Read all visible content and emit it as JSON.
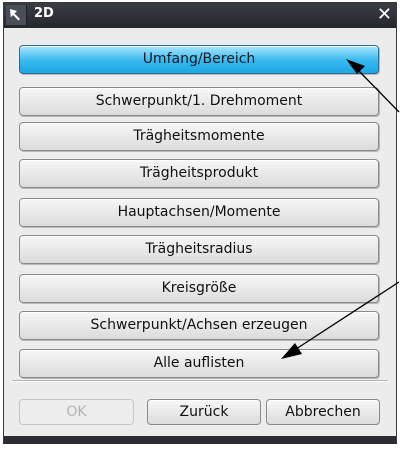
{
  "window": {
    "title": "2D",
    "icon": "cursor-arrow-icon",
    "close_glyph": "✕"
  },
  "menu": {
    "items": [
      {
        "label": "Umfang/Bereich",
        "active": true
      },
      {
        "label": "Schwerpunkt/1. Drehmoment"
      },
      {
        "label": "Trägheitsmomente"
      },
      {
        "label": "Trägheitsprodukt"
      },
      {
        "label": "Hauptachsen/Momente"
      },
      {
        "label": "Trägheitsradius"
      },
      {
        "label": "Kreisgröße"
      },
      {
        "label": "Schwerpunkt/Achsen erzeugen"
      },
      {
        "label": "Alle auflisten"
      }
    ]
  },
  "buttons": {
    "ok": "OK",
    "back": "Zurück",
    "cancel": "Abbrechen"
  },
  "colors": {
    "active_button": "#37b8ee",
    "title_bar": "#2b2e34",
    "dialog_bg": "#ececec"
  }
}
